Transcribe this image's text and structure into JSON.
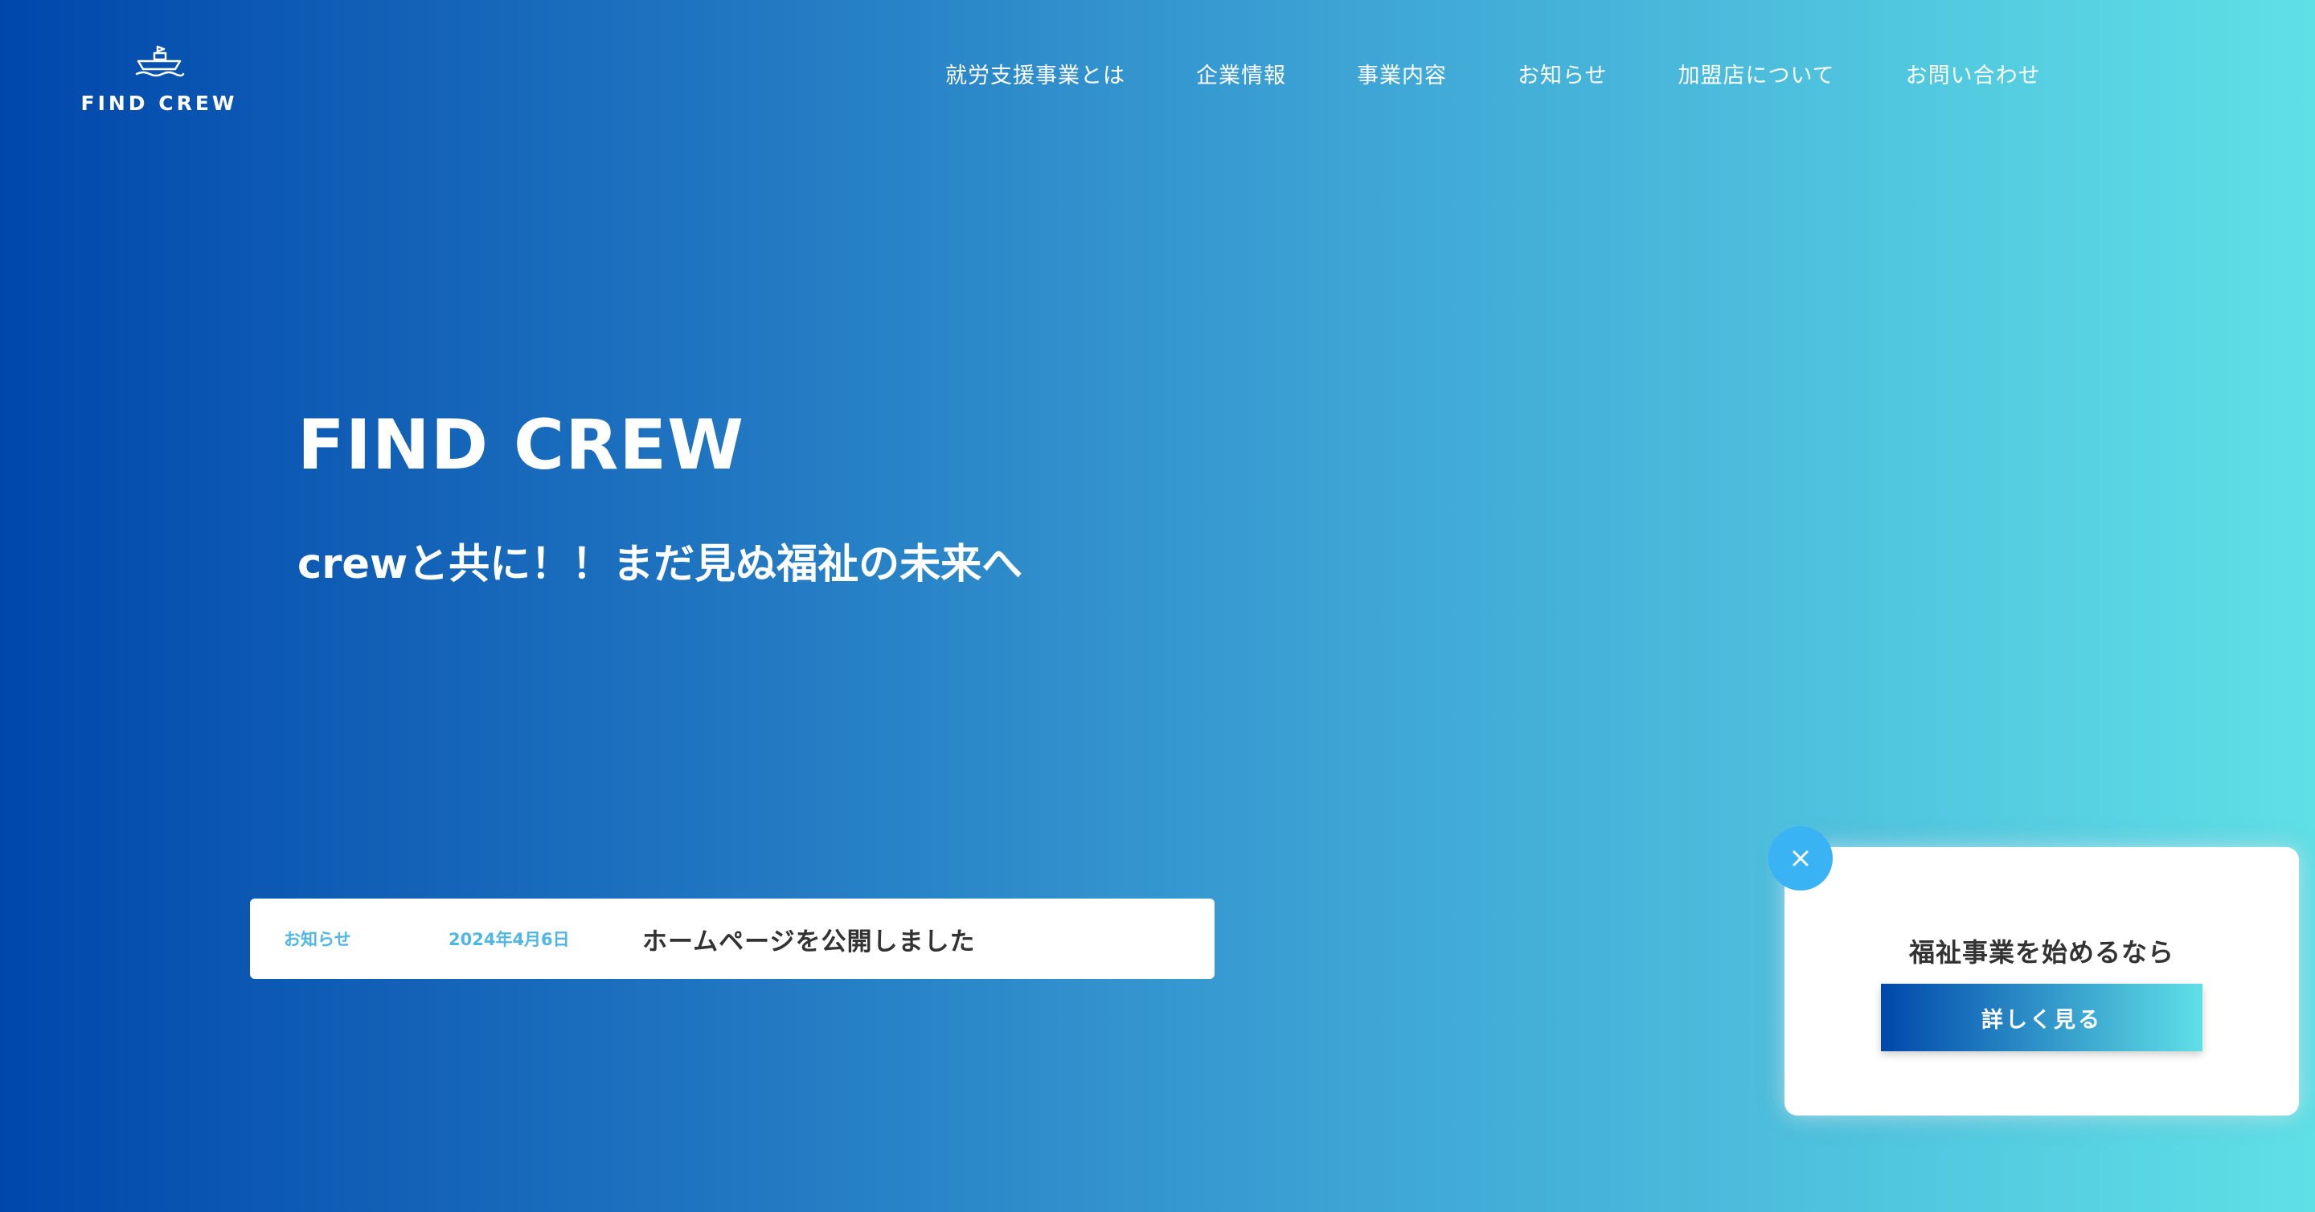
{
  "header": {
    "logo_text": "FIND CREW",
    "logo_icon": "ship-icon",
    "nav": [
      {
        "label": "就労支援事業とは"
      },
      {
        "label": "企業情報"
      },
      {
        "label": "事業内容"
      },
      {
        "label": "お知らせ"
      },
      {
        "label": "加盟店について"
      },
      {
        "label": "お問い合わせ"
      }
    ]
  },
  "hero": {
    "title": "FIND CREW",
    "subtitle": "crewと共に！！まだ見ぬ福祉の未来へ"
  },
  "news": {
    "category": "お知らせ",
    "date": "2024年4月6日",
    "title": "ホームページを公開しました"
  },
  "popup": {
    "text": "福祉事業を始めるなら",
    "button_label": "詳しく見る",
    "close_icon": "close-icon"
  },
  "colors": {
    "gradient_start": "#0047ab",
    "gradient_end": "#5fe0e6",
    "accent": "#4fb7e3",
    "close_button": "#3ab3f5"
  }
}
